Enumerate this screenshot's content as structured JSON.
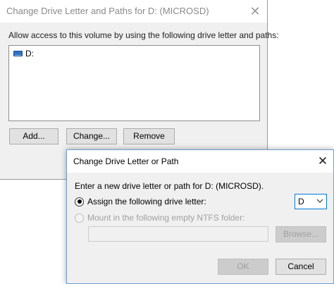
{
  "outer_dialog": {
    "title": "Change Drive Letter and Paths for D: (MICROSD)",
    "close_glyph": "✕",
    "instruction": "Allow access to this volume by using the following drive letter and paths:",
    "list_items": [
      {
        "label": "D:",
        "icon": "drive-icon"
      }
    ],
    "buttons": {
      "add": "Add...",
      "change": "Change...",
      "remove": "Remove"
    }
  },
  "inner_dialog": {
    "title": "Change Drive Letter or Path",
    "close_glyph": "✕",
    "instruction": "Enter a new drive letter or path for D: (MICROSD).",
    "assign_option": {
      "label": "Assign the following drive letter:",
      "checked": true
    },
    "drive_letter_select": {
      "value": "D"
    },
    "mount_option": {
      "label": "Mount in the following empty NTFS folder:",
      "checked": false,
      "disabled": true
    },
    "folder_path": {
      "value": ""
    },
    "buttons": {
      "browse": "Browse...",
      "ok": "OK",
      "cancel": "Cancel"
    }
  },
  "colors": {
    "accent": "#0078d7",
    "dialog_bg": "#f0f0f0",
    "disabled_text": "#a0a0a0"
  }
}
